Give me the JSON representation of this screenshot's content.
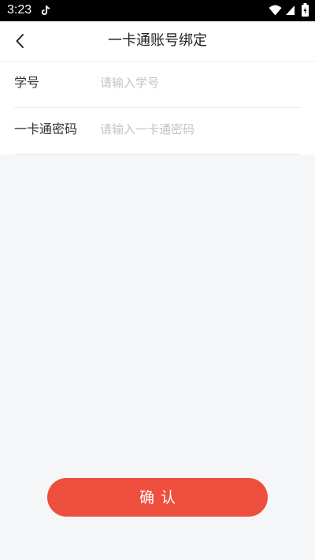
{
  "status_bar": {
    "time": "3:23",
    "icons": [
      "tiktok-icon",
      "wifi-icon",
      "signal-icon",
      "battery-icon"
    ]
  },
  "nav": {
    "back_icon": "chevron-left-icon",
    "title": "一卡通账号绑定"
  },
  "form": {
    "student_id": {
      "label": "学号",
      "placeholder": "请输入学号",
      "value": ""
    },
    "password": {
      "label": "一卡通密码",
      "placeholder": "请输入一卡通密码",
      "value": ""
    }
  },
  "confirm_button": {
    "label": "确认"
  },
  "colors": {
    "accent": "#ee4e3d",
    "background": "#f5f6f8",
    "status_bar": "#000000"
  }
}
